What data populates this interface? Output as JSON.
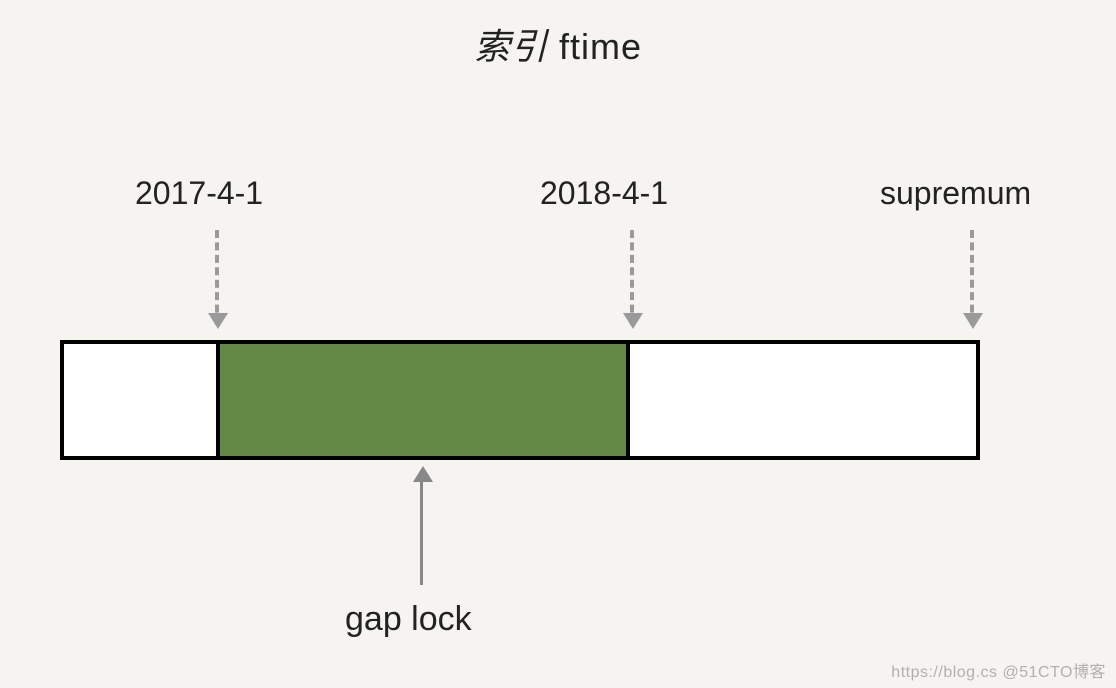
{
  "title": {
    "prefix_cjk": "索引",
    "suffix": " ftime"
  },
  "markers": {
    "start": {
      "label": "2017-4-1"
    },
    "end": {
      "label": "2018-4-1"
    },
    "supremum": {
      "label": "supremum"
    }
  },
  "gap_lock": {
    "label": "gap lock",
    "fill_color": "#628a46",
    "range": [
      "2017-4-1",
      "2018-4-1"
    ]
  },
  "segments": [
    {
      "name": "before-start",
      "locked": false
    },
    {
      "name": "gap-lock-range",
      "locked": true
    },
    {
      "name": "after-end-to-supremum",
      "locked": false
    }
  ],
  "watermark": "https://blog.cs @51CTO博客"
}
